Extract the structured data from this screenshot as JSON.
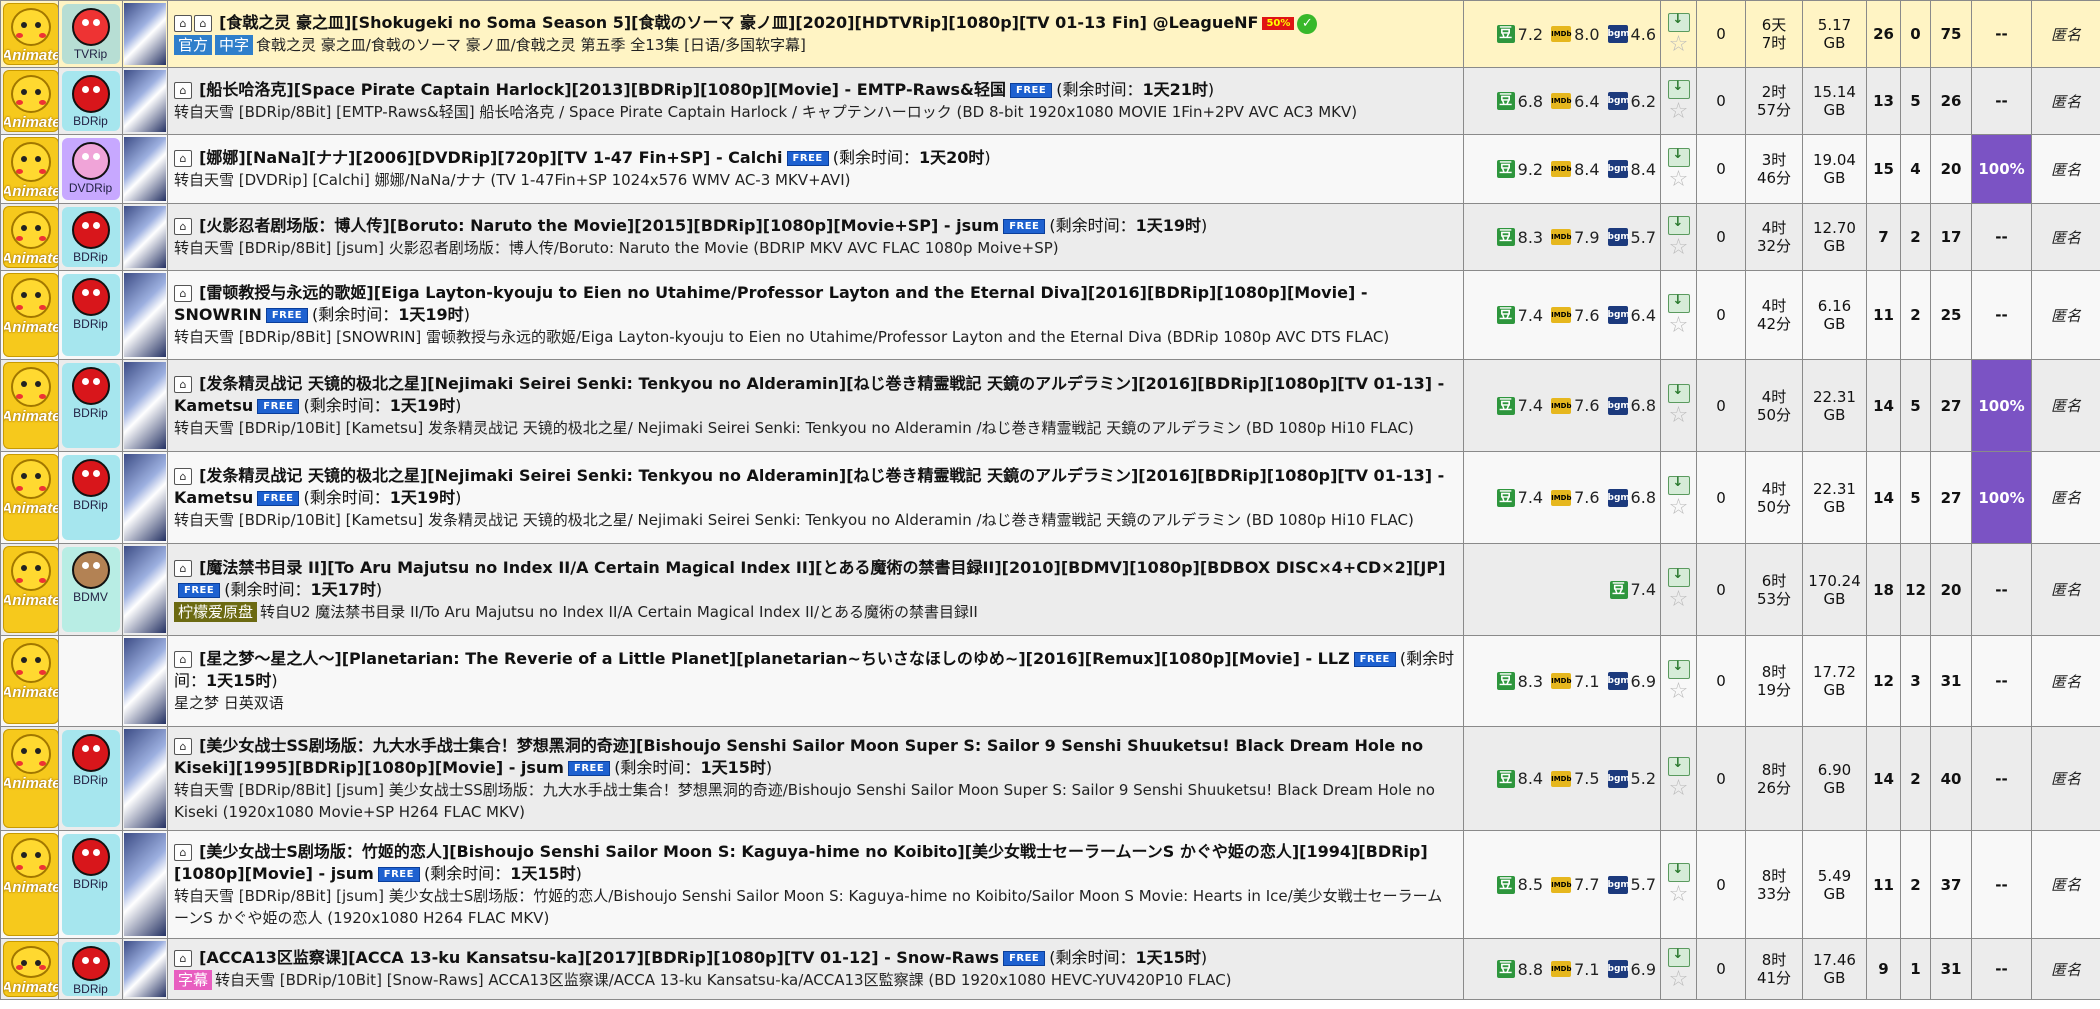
{
  "labels": {
    "anonymous": "匿名",
    "remaining_prefix": "(剩余时间：",
    "remaining_suffix": ")",
    "free_badge": "FREE",
    "dash": "--"
  },
  "colors": {
    "free": "#1e61d0",
    "progress_full": "#7b53c4",
    "sticky_bg": "#fff4c4",
    "douban": "#2e963d",
    "imdb": "#e6b71e"
  },
  "rows": [
    {
      "style": "sticky",
      "height": 66,
      "category": "Animate",
      "source": "TVRip",
      "source_kind": "tv",
      "title": "[食戟之灵 豪之皿][Shokugeki no Soma Season 5][食戟のソーマ 豪ノ皿][2020][HDTVRip][1080p][TV 01-13 Fin] @LeagueNF",
      "badge": "50%",
      "free": false,
      "remaining": "",
      "check": true,
      "tags": [
        {
          "text": "官方",
          "color": "blue"
        },
        {
          "text": "中字",
          "color": "blue"
        }
      ],
      "subtitle": "食戟之灵 豪之皿/食戟のソーマ 豪ノ皿/食戟之灵 第五季 全13集 [日语/多国软字幕]",
      "douban": "7.2",
      "imdb": "8.0",
      "bgm": "4.6",
      "comments": "0",
      "time": [
        "6天",
        "7时"
      ],
      "size": [
        "5.17",
        "GB"
      ],
      "seeders": "26",
      "leechers": "0",
      "completed": "75",
      "progress": "--"
    },
    {
      "style": "odd",
      "height": 66,
      "category": "Animate",
      "source": "BDRip",
      "source_kind": "bd",
      "title": "[船长哈洛克][Space Pirate Captain Harlock][2013][BDRip][1080p][Movie] - EMTP-Raws&轻国",
      "badge": "",
      "free": true,
      "remaining": "1天21时",
      "check": false,
      "tags": [],
      "subtitle": "转自天雪 [BDRip/8Bit] [EMTP-Raws&轻国] 船长哈洛克 / Space Pirate Captain Harlock / キャプテンハーロック (BD 8-bit 1920x1080 MOVIE 1Fin+2PV AVC AC3 MKV)",
      "douban": "6.8",
      "imdb": "6.4",
      "bgm": "6.2",
      "comments": "0",
      "time": [
        "2时",
        "57分"
      ],
      "size": [
        "15.14",
        "GB"
      ],
      "seeders": "13",
      "leechers": "5",
      "completed": "26",
      "progress": "--"
    },
    {
      "style": "even",
      "height": 68,
      "category": "Animate",
      "source": "DVDRip",
      "source_kind": "dvd",
      "title": "[娜娜][NaNa][ナナ][2006][DVDRip][720p][TV 1-47 Fin+SP] - Calchi",
      "badge": "",
      "free": true,
      "remaining": "1天20时",
      "check": false,
      "tags": [],
      "subtitle": "转自天雪 [DVDRip] [Calchi] 娜娜/NaNa/ナナ (TV 1-47Fin+SP 1024x576 WMV AC-3 MKV+AVI)",
      "douban": "9.2",
      "imdb": "8.4",
      "bgm": "8.4",
      "comments": "0",
      "time": [
        "3时",
        "46分"
      ],
      "size": [
        "19.04",
        "GB"
      ],
      "seeders": "15",
      "leechers": "4",
      "completed": "20",
      "progress": "100%"
    },
    {
      "style": "odd",
      "height": 66,
      "category": "Animate",
      "source": "BDRip",
      "source_kind": "bd",
      "title": "[火影忍者剧场版：博人传][Boruto: Naruto the Movie][2015][BDRip][1080p][Movie+SP] - jsum",
      "badge": "",
      "free": true,
      "remaining": "1天19时",
      "check": false,
      "tags": [],
      "subtitle": "转自天雪 [BDRip/8Bit] [jsum] 火影忍者剧场版：博人传/Boruto: Naruto the Movie (BDRIP MKV AVC FLAC 1080p Moive+SP)",
      "douban": "8.3",
      "imdb": "7.9",
      "bgm": "5.7",
      "comments": "0",
      "time": [
        "4时",
        "32分"
      ],
      "size": [
        "12.70",
        "GB"
      ],
      "seeders": "7",
      "leechers": "2",
      "completed": "17",
      "progress": "--"
    },
    {
      "style": "even",
      "height": 88,
      "category": "Animate",
      "source": "BDRip",
      "source_kind": "bd",
      "title": "[雷顿教授与永远的歌姬][Eiga Layton-kyouju to Eien no Utahime/Professor Layton and the Eternal Diva][2016][BDRip][1080p][Movie] - SNOWRIN",
      "badge": "",
      "free": true,
      "remaining": "1天19时",
      "check": false,
      "tags": [],
      "subtitle": "转自天雪 [BDRip/8Bit] [SNOWRIN] 雷顿教授与永远的歌姬/Eiga Layton-kyouju to Eien no Utahime/Professor Layton and the Eternal Diva (BDRip 1080p AVC DTS FLAC)",
      "douban": "7.4",
      "imdb": "7.6",
      "bgm": "6.4",
      "comments": "0",
      "time": [
        "4时",
        "42分"
      ],
      "size": [
        "6.16",
        "GB"
      ],
      "seeders": "11",
      "leechers": "2",
      "completed": "25",
      "progress": "--"
    },
    {
      "style": "odd",
      "height": 91,
      "category": "Animate",
      "source": "BDRip",
      "source_kind": "bd",
      "title": "[发条精灵战记 天镜的极北之星][Nejimaki Seirei Senki: Tenkyou no Alderamin][ねじ巻き精霊戦記 天鏡のアルデラミン][2016][BDRip][1080p][TV 01-13] - Kametsu",
      "badge": "",
      "free": true,
      "remaining": "1天19时",
      "check": false,
      "tags": [],
      "subtitle": "转自天雪 [BDRip/10Bit] [Kametsu] 发条精灵战记 天镜的极北之星/ Nejimaki Seirei Senki: Tenkyou no Alderamin /ねじ巻き精霊戦記 天鏡のアルデラミン (BD 1080p Hi10 FLAC)",
      "douban": "7.4",
      "imdb": "7.6",
      "bgm": "6.8",
      "comments": "0",
      "time": [
        "4时",
        "50分"
      ],
      "size": [
        "22.31",
        "GB"
      ],
      "seeders": "14",
      "leechers": "5",
      "completed": "27",
      "progress": "100%"
    },
    {
      "style": "even",
      "height": 91,
      "category": "Animate",
      "source": "BDRip",
      "source_kind": "bd",
      "title": "[发条精灵战记 天镜的极北之星][Nejimaki Seirei Senki: Tenkyou no Alderamin][ねじ巻き精霊戦記 天鏡のアルデラミン][2016][BDRip][1080p][TV 01-13] - Kametsu",
      "badge": "",
      "free": true,
      "remaining": "1天19时",
      "check": false,
      "tags": [],
      "subtitle": "转自天雪 [BDRip/10Bit] [Kametsu] 发条精灵战记 天镜的极北之星/ Nejimaki Seirei Senki: Tenkyou no Alderamin /ねじ巻き精霊戦記 天鏡のアルデラミン (BD 1080p Hi10 FLAC)",
      "douban": "7.4",
      "imdb": "7.6",
      "bgm": "6.8",
      "comments": "0",
      "time": [
        "4时",
        "50分"
      ],
      "size": [
        "22.31",
        "GB"
      ],
      "seeders": "14",
      "leechers": "5",
      "completed": "27",
      "progress": "100%"
    },
    {
      "style": "odd",
      "height": 91,
      "category": "Animate",
      "source": "BDMV",
      "source_kind": "bdmv",
      "title": "[魔法禁书目录 II][To Aru Majutsu no Index II/A Certain Magical Index II][とある魔術の禁書目録II][2010][BDMV][1080p][BDBOX DISC×4+CD×2][JP]",
      "badge": "",
      "free": true,
      "remaining": "1天17时",
      "check": false,
      "tags": [
        {
          "text": "柠檬爱原盘",
          "color": "gold"
        }
      ],
      "subtitle": "转自U2 魔法禁书目录 II/To Aru Majutsu no Index II/A Certain Magical Index II/とある魔術の禁書目録II",
      "douban": "7.4",
      "imdb": "",
      "bgm": "",
      "comments": "0",
      "time": [
        "6时",
        "53分"
      ],
      "size": [
        "170.24",
        "GB"
      ],
      "seeders": "18",
      "leechers": "12",
      "completed": "20",
      "progress": "--"
    },
    {
      "style": "even",
      "height": 90,
      "category": "Animate",
      "source": "",
      "source_kind": "none",
      "title": "[星之梦～星之人～][Planetarian: The Reverie of a Little Planet][planetarian~ちいさなほしのゆめ~][2016][Remux][1080p][Movie] - LLZ",
      "badge": "",
      "free": true,
      "remaining": "1天15时",
      "check": false,
      "tags": [],
      "subtitle": "星之梦 日英双语",
      "douban": "8.3",
      "imdb": "7.1",
      "bgm": "6.9",
      "comments": "0",
      "time": [
        "8时",
        "19分"
      ],
      "size": [
        "17.72",
        "GB"
      ],
      "seeders": "12",
      "leechers": "3",
      "completed": "31",
      "progress": "--"
    },
    {
      "style": "odd",
      "height": 103,
      "category": "Animate",
      "source": "BDRip",
      "source_kind": "bd",
      "title": "[美少女战士SS剧场版：九大水手战士集合！梦想黑洞的奇迹][Bishoujo Senshi Sailor Moon Super S: Sailor 9 Senshi Shuuketsu! Black Dream Hole no Kiseki][1995][BDRip][1080p][Movie] - jsum",
      "badge": "",
      "free": true,
      "remaining": "1天15时",
      "check": false,
      "tags": [],
      "subtitle": "转自天雪 [BDRip/8Bit] [jsum] 美少女战士SS剧场版：九大水手战士集合！梦想黑洞的奇迹/Bishoujo Senshi Sailor Moon Super S: Sailor 9 Senshi Shuuketsu! Black Dream Hole no Kiseki (1920x1080 Movie+SP H264 FLAC MKV)",
      "douban": "8.4",
      "imdb": "7.5",
      "bgm": "5.2",
      "comments": "0",
      "time": [
        "8时",
        "26分"
      ],
      "size": [
        "6.90",
        "GB"
      ],
      "seeders": "14",
      "leechers": "2",
      "completed": "40",
      "progress": "--"
    },
    {
      "style": "even",
      "height": 107,
      "category": "Animate",
      "source": "BDRip",
      "source_kind": "bd",
      "title": "[美少女战士S剧场版：竹姬的恋人][Bishoujo Senshi Sailor Moon S: Kaguya-hime no Koibito][美少女戦士セーラームーンS かぐや姫の恋人][1994][BDRip][1080p][Movie] - jsum",
      "badge": "",
      "free": true,
      "remaining": "1天15时",
      "check": false,
      "tags": [],
      "subtitle": "转自天雪 [BDRip/8Bit] [jsum] 美少女战士S剧场版：竹姬的恋人/Bishoujo Senshi Sailor Moon S: Kaguya-hime no Koibito/Sailor Moon S Movie: Hearts in Ice/美少女戦士セーラームーンS かぐや姫の恋人 (1920x1080 H264 FLAC MKV)",
      "douban": "8.5",
      "imdb": "7.7",
      "bgm": "5.7",
      "comments": "0",
      "time": [
        "8时",
        "33分"
      ],
      "size": [
        "5.49",
        "GB"
      ],
      "seeders": "11",
      "leechers": "2",
      "completed": "37",
      "progress": "--"
    },
    {
      "style": "odd",
      "height": 60,
      "category": "Animate",
      "source": "BDRip",
      "source_kind": "bd",
      "title": "[ACCA13区监察课][ACCA 13-ku Kansatsu-ka][2017][BDRip][1080p][TV 01-12] - Snow-Raws",
      "badge": "",
      "free": true,
      "remaining": "1天15时",
      "check": false,
      "tags": [
        {
          "text": "字幕",
          "color": "pink"
        }
      ],
      "subtitle": "转自天雪 [BDRip/10Bit] [Snow-Raws] ACCA13区监察课/ACCA 13-ku Kansatsu-ka/ACCA13区監察課 (BD 1920x1080 HEVC-YUV420P10 FLAC)",
      "douban": "8.8",
      "imdb": "7.1",
      "bgm": "6.9",
      "comments": "0",
      "time": [
        "8时",
        "41分"
      ],
      "size": [
        "17.46",
        "GB"
      ],
      "seeders": "9",
      "leechers": "1",
      "completed": "31",
      "progress": "--"
    }
  ]
}
